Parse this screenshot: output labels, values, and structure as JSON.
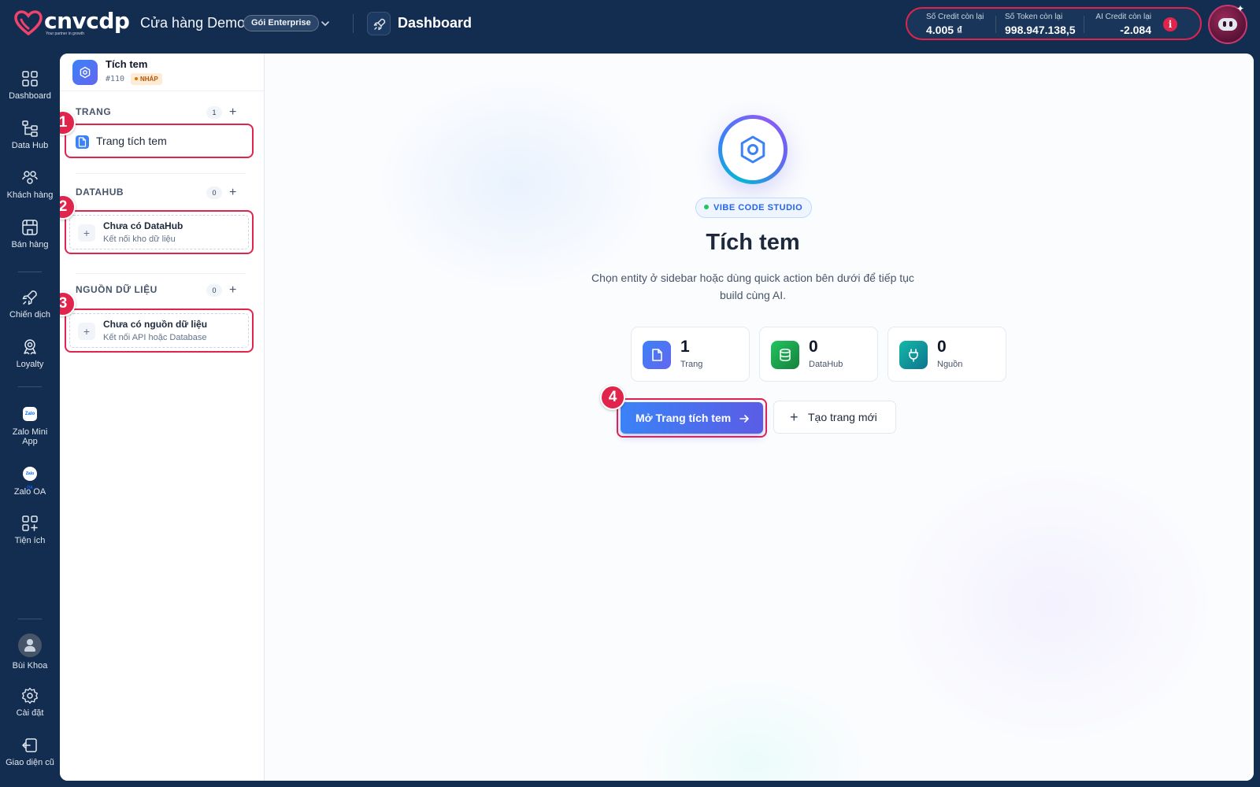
{
  "brand": {
    "name": "cnvcdp",
    "tagline": "Your partner in growth",
    "accent": "#e0244c"
  },
  "store": {
    "name": "Cửa hàng Demo",
    "plan": "Gói Enterprise"
  },
  "header": {
    "page_title": "Dashboard"
  },
  "credits": [
    {
      "label": "Số Credit còn lại",
      "value": "4.005 ₫"
    },
    {
      "label": "Số Token còn lại",
      "value": "998.947.138,5"
    },
    {
      "label": "AI Credit còn lại",
      "value": "-2.084"
    }
  ],
  "info_icon": "i",
  "nav": {
    "items": [
      {
        "label": "Dashboard",
        "icon": "grid-icon"
      },
      {
        "label": "Data Hub",
        "icon": "hierarchy-icon"
      },
      {
        "label": "Khách hàng",
        "icon": "users-icon"
      },
      {
        "label": "Bán hàng",
        "icon": "store-icon"
      },
      {
        "label": "Chiến dịch",
        "icon": "rocket-icon"
      },
      {
        "label": "Loyalty",
        "icon": "award-icon"
      },
      {
        "label": "Zalo Mini App",
        "icon": "zalo-mini-app-icon",
        "chip": "Zalo"
      },
      {
        "label": "Zalo OA",
        "icon": "zalo-oa-icon",
        "chip": "Zalo OA"
      },
      {
        "label": "Tiện ích",
        "icon": "add-widgets-icon"
      }
    ],
    "bottom": [
      {
        "label": "Bùi Khoa",
        "icon": "user-avatar"
      },
      {
        "label": "Cài đặt",
        "icon": "gear-icon"
      },
      {
        "label": "Giao diện cũ",
        "icon": "legacy-ui-icon"
      }
    ]
  },
  "project": {
    "title": "Tích tem",
    "id": "#110",
    "status": "NHÁP"
  },
  "sections": {
    "pages": {
      "title": "TRANG",
      "count": "1",
      "items": [
        {
          "label": "Trang tích tem"
        }
      ]
    },
    "datahub": {
      "title": "DATAHUB",
      "count": "0",
      "empty_title": "Chưa có DataHub",
      "empty_desc": "Kết nối kho dữ liệu"
    },
    "sources": {
      "title": "NGUỒN DỮ LIỆU",
      "count": "0",
      "empty_title": "Chưa có nguồn dữ liệu",
      "empty_desc": "Kết nối API hoặc Database"
    }
  },
  "steps": [
    "1",
    "2",
    "3",
    "4"
  ],
  "hero": {
    "pill": "VIBE CODE STUDIO",
    "title": "Tích tem",
    "subtitle": "Chọn entity ở sidebar hoặc dùng quick action bên dưới để tiếp tục build cùng AI."
  },
  "stats": [
    {
      "value": "1",
      "label": "Trang",
      "color": "#4f6ef0"
    },
    {
      "value": "0",
      "label": "DataHub",
      "color": "#16a34a"
    },
    {
      "value": "0",
      "label": "Nguồn",
      "color": "#0e9aa7"
    }
  ],
  "actions": {
    "open": "Mở Trang tích tem",
    "create": "Tạo trang mới",
    "create_icon": "+"
  }
}
